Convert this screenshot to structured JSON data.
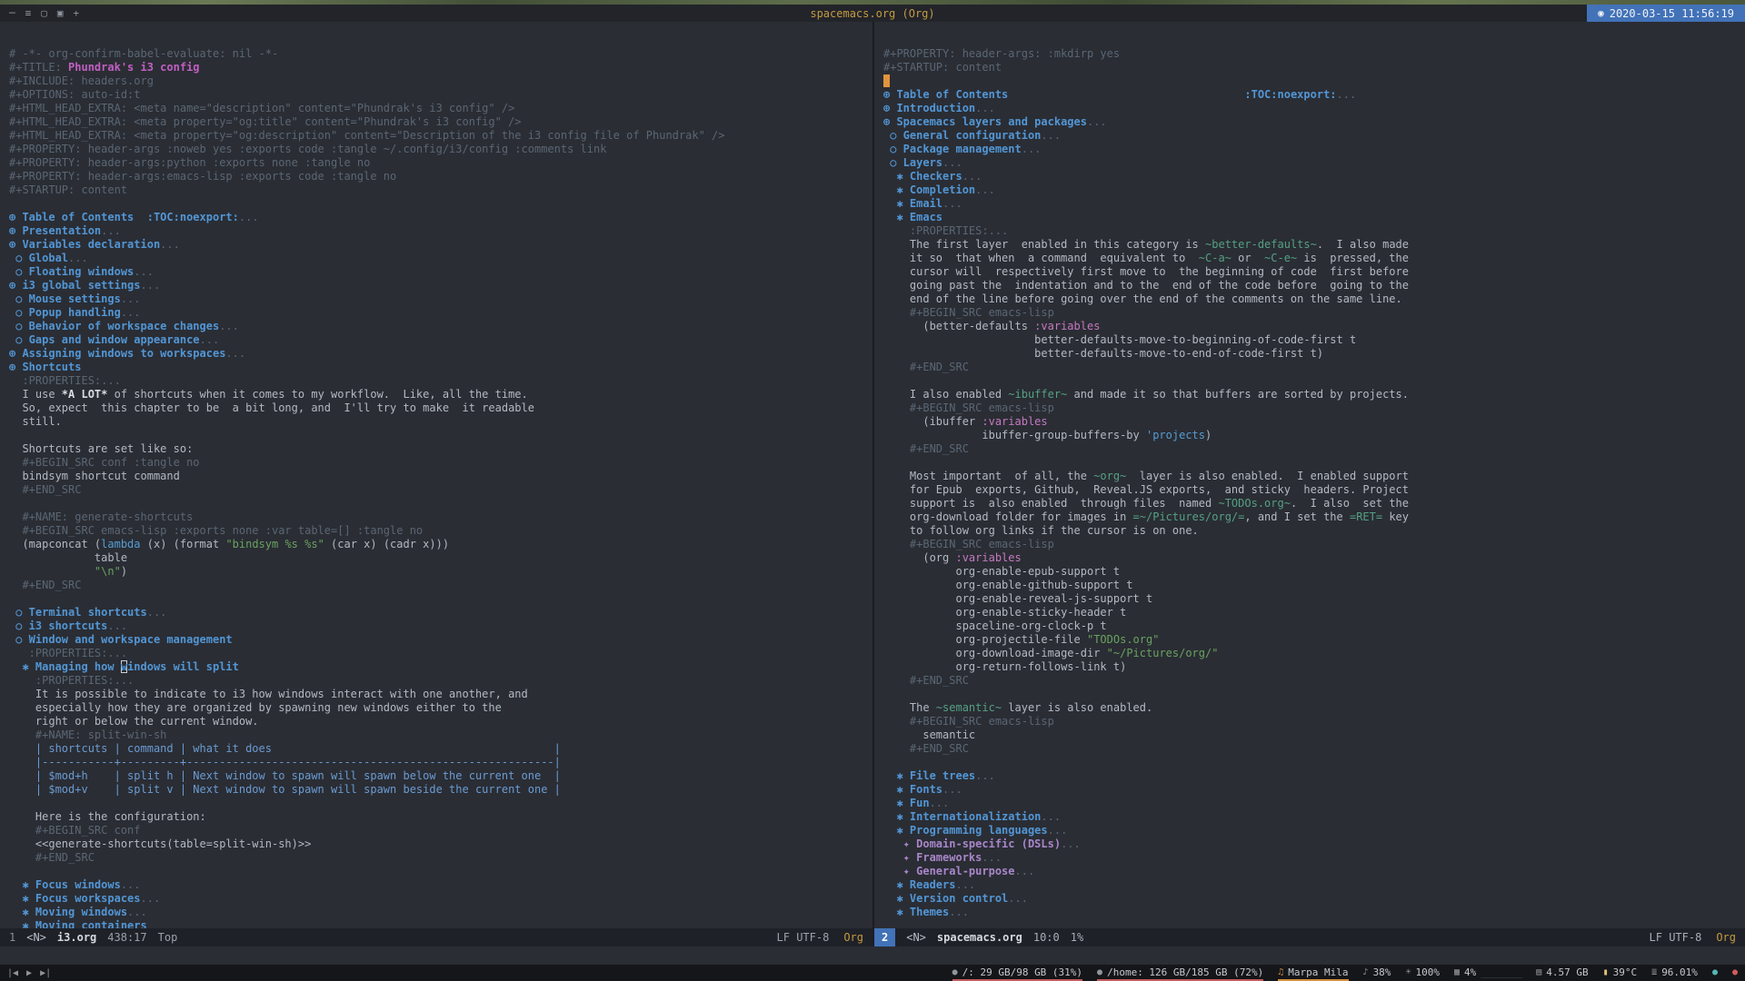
{
  "titlebar": {
    "title": "spacemacs.org (Org)",
    "clock": "2020-03-15 11:56:19",
    "clock_icon": "◉",
    "icons": [
      {
        "name": "minimize-icon",
        "glyph": "─"
      },
      {
        "name": "menu-icon",
        "glyph": "≡"
      },
      {
        "name": "window-icon",
        "glyph": "▢"
      },
      {
        "name": "grid-icon",
        "glyph": "▣"
      },
      {
        "name": "plus-icon",
        "glyph": "+"
      }
    ]
  },
  "left_window": {
    "modeline": {
      "win": "1",
      "state": "<N>",
      "buffer": "i3.org",
      "position": "438:17",
      "scroll": "Top",
      "encoding": "LF UTF-8",
      "mode": "Org"
    },
    "lines": [
      [
        [
          "m",
          "# -*- org-confirm-babel-evaluate: nil -*-"
        ]
      ],
      [
        [
          "m",
          "#+TITLE: "
        ],
        [
          "ti",
          "Phundrak's i3 config"
        ]
      ],
      [
        [
          "m",
          "#+INCLUDE: headers.org"
        ]
      ],
      [
        [
          "m",
          "#+OPTIONS: auto-id:t"
        ]
      ],
      [
        [
          "m",
          "#+HTML_HEAD_EXTRA: <meta name=\"description\" content=\"Phundrak's i3 config\" />"
        ]
      ],
      [
        [
          "m",
          "#+HTML_HEAD_EXTRA: <meta property=\"og:title\" content=\"Phundrak's i3 config\" />"
        ]
      ],
      [
        [
          "m",
          "#+HTML_HEAD_EXTRA: <meta property=\"og:description\" content=\"Description of the i3 config file of Phundrak\" />"
        ]
      ],
      [
        [
          "m",
          "#+PROPERTY: header-args :noweb yes :exports code :tangle ~/.config/i3/config :comments link"
        ]
      ],
      [
        [
          "m",
          "#+PROPERTY: header-args:python :exports none :tangle no"
        ]
      ],
      [
        [
          "m",
          "#+PROPERTY: header-args:emacs-lisp :exports code :tangle no"
        ]
      ],
      [
        [
          "m",
          "#+STARTUP: content"
        ]
      ],
      [],
      [
        [
          "h1",
          "⊕ Table of Contents  :TOC:noexport:"
        ],
        [
          "el",
          "..."
        ]
      ],
      [
        [
          "h1",
          "⊕ Presentation"
        ],
        [
          "el",
          "..."
        ]
      ],
      [
        [
          "h1",
          "⊕ Variables declaration"
        ],
        [
          "el",
          "..."
        ]
      ],
      [
        [
          "h2",
          " ○ Global"
        ],
        [
          "el",
          "..."
        ]
      ],
      [
        [
          "h2",
          " ○ Floating windows"
        ],
        [
          "el",
          "..."
        ]
      ],
      [
        [
          "h1",
          "⊕ i3 global settings"
        ],
        [
          "el",
          "..."
        ]
      ],
      [
        [
          "h2",
          " ○ Mouse settings"
        ],
        [
          "el",
          "..."
        ]
      ],
      [
        [
          "h2",
          " ○ Popup handling"
        ],
        [
          "el",
          "..."
        ]
      ],
      [
        [
          "h2",
          " ○ Behavior of workspace changes"
        ],
        [
          "el",
          "..."
        ]
      ],
      [
        [
          "h2",
          " ○ Gaps and window appearance"
        ],
        [
          "el",
          "..."
        ]
      ],
      [
        [
          "h1",
          "⊕ Assigning windows to workspaces"
        ],
        [
          "el",
          "..."
        ]
      ],
      [
        [
          "h1",
          "⊕ Shortcuts"
        ]
      ],
      [
        [
          "m",
          "  :PROPERTIES:..."
        ]
      ],
      [
        [
          "t",
          "  I use "
        ],
        [
          "b",
          "*A LOT*"
        ],
        [
          "t",
          " of shortcuts when it comes to my workflow.  Like, all the time."
        ]
      ],
      [
        [
          "t",
          "  So, expect  this chapter to be  a bit long, and  I'll try to make  it readable"
        ]
      ],
      [
        [
          "t",
          "  still."
        ]
      ],
      [],
      [
        [
          "t",
          "  Shortcuts are set like so:"
        ]
      ],
      [
        [
          "m",
          "  #+BEGIN_SRC conf :tangle no"
        ]
      ],
      [
        [
          "t",
          "  bindsym shortcut command"
        ]
      ],
      [
        [
          "m",
          "  #+END_SRC"
        ]
      ],
      [],
      [
        [
          "m",
          "  #+NAME: generate-shortcuts"
        ]
      ],
      [
        [
          "m",
          "  #+BEGIN_SRC emacs-lisp :exports none :var table=[] :tangle no"
        ]
      ],
      [
        [
          "t",
          "  (mapconcat ("
        ],
        [
          "kw",
          "lambda"
        ],
        [
          "t",
          " (x) (format "
        ],
        [
          "st",
          "\"bindsym %s %s\""
        ],
        [
          "t",
          " (car x) (cadr x)))"
        ]
      ],
      [
        [
          "t",
          "             table"
        ]
      ],
      [
        [
          "t",
          "             "
        ],
        [
          "st",
          "\"\\n\""
        ],
        [
          "t",
          ")"
        ]
      ],
      [
        [
          "m",
          "  #+END_SRC"
        ]
      ],
      [],
      [
        [
          "h2",
          " ○ Terminal shortcuts"
        ],
        [
          "el",
          "..."
        ]
      ],
      [
        [
          "h2",
          " ○ i3 shortcuts"
        ],
        [
          "el",
          "..."
        ]
      ],
      [
        [
          "h2",
          " ○ Window and workspace management"
        ]
      ],
      [
        [
          "m",
          "   :PROPERTIES:..."
        ]
      ],
      [
        [
          "h3",
          "  ✱ Managing how "
        ],
        [
          "hcur",
          "w"
        ],
        [
          "h3",
          "indows will split"
        ]
      ],
      [
        [
          "m",
          "    :PROPERTIES:..."
        ]
      ],
      [
        [
          "t",
          "    It is possible to indicate to i3 how windows interact with one another, and"
        ]
      ],
      [
        [
          "t",
          "    especially how they are organized by spawning new windows either to the"
        ]
      ],
      [
        [
          "t",
          "    right or below the current window."
        ]
      ],
      [
        [
          "m",
          "    #+NAME: split-win-sh"
        ]
      ],
      [
        [
          "tb",
          "    | shortcuts | command | what it does                                           |"
        ]
      ],
      [
        [
          "tb",
          "    |-----------+---------+--------------------------------------------------------|"
        ]
      ],
      [
        [
          "tb",
          "    | $mod+h    | split h | Next window to spawn will spawn below the current one  |"
        ]
      ],
      [
        [
          "tb",
          "    | $mod+v    | split v | Next window to spawn will spawn beside the current one |"
        ]
      ],
      [],
      [
        [
          "t",
          "    Here is the configuration:"
        ]
      ],
      [
        [
          "m",
          "    #+BEGIN_SRC conf"
        ]
      ],
      [
        [
          "t",
          "    <<generate-shortcuts(table=split-win-sh)>>"
        ]
      ],
      [
        [
          "m",
          "    #+END_SRC"
        ]
      ],
      [],
      [
        [
          "h3",
          "  ✱ Focus windows"
        ],
        [
          "el",
          "..."
        ]
      ],
      [
        [
          "h3",
          "  ✱ Focus workspaces"
        ],
        [
          "el",
          "..."
        ]
      ],
      [
        [
          "h3",
          "  ✱ Moving windows"
        ],
        [
          "el",
          "..."
        ]
      ],
      [
        [
          "h3",
          "  ✱ Moving containers"
        ]
      ]
    ]
  },
  "right_window": {
    "modeline": {
      "win": "2",
      "state": "<N>",
      "buffer": "spacemacs.org",
      "position": "10:0",
      "scroll": "1%",
      "encoding": "LF UTF-8",
      "mode": "Org"
    },
    "lines": [
      [
        [
          "m",
          "#+PROPERTY: header-args: :mkdirp yes"
        ]
      ],
      [
        [
          "m",
          "#+STARTUP: content"
        ]
      ],
      [
        [
          "cur",
          " "
        ]
      ],
      [
        [
          "h1",
          "⊕ Table of Contents"
        ],
        [
          "t",
          "                                    "
        ],
        [
          "h1",
          ":TOC:noexport:"
        ],
        [
          "el",
          "..."
        ]
      ],
      [
        [
          "h1",
          "⊕ Introduction"
        ],
        [
          "el",
          "..."
        ]
      ],
      [
        [
          "h1",
          "⊕ Spacemacs layers and packages"
        ],
        [
          "el",
          "..."
        ]
      ],
      [
        [
          "h2",
          " ○ General configuration"
        ],
        [
          "el",
          "..."
        ]
      ],
      [
        [
          "h2",
          " ○ Package management"
        ],
        [
          "el",
          "..."
        ]
      ],
      [
        [
          "h2",
          " ○ Layers"
        ],
        [
          "el",
          "..."
        ]
      ],
      [
        [
          "h3",
          "  ✱ Checkers"
        ],
        [
          "el",
          "..."
        ]
      ],
      [
        [
          "h3",
          "  ✱ Completion"
        ],
        [
          "el",
          "..."
        ]
      ],
      [
        [
          "h3",
          "  ✱ Email"
        ],
        [
          "el",
          "..."
        ]
      ],
      [
        [
          "h3",
          "  ✱ Emacs"
        ]
      ],
      [
        [
          "m",
          "    :PROPERTIES:..."
        ]
      ],
      [
        [
          "t",
          "    The first layer  enabled in this category is "
        ],
        [
          "cd",
          "~better-defaults~"
        ],
        [
          "t",
          ".  I also made"
        ]
      ],
      [
        [
          "t",
          "    it so  that when  a command  equivalent to  "
        ],
        [
          "cd",
          "~C-a~"
        ],
        [
          "t",
          " or  "
        ],
        [
          "cd",
          "~C-e~"
        ],
        [
          "t",
          " is  pressed, the"
        ]
      ],
      [
        [
          "t",
          "    cursor will  respectively first move to  the beginning of code  first before"
        ]
      ],
      [
        [
          "t",
          "    going past the  indentation and to the  end of the code before  going to the"
        ]
      ],
      [
        [
          "t",
          "    end of the line before going over the end of the comments on the same line."
        ]
      ],
      [
        [
          "m",
          "    #+BEGIN_SRC emacs-lisp"
        ]
      ],
      [
        [
          "t",
          "      (better-defaults "
        ],
        [
          "ct",
          ":variables"
        ]
      ],
      [
        [
          "t",
          "                       better-defaults-move-to-beginning-of-code-first t"
        ]
      ],
      [
        [
          "t",
          "                       better-defaults-move-to-end-of-code-first t)"
        ]
      ],
      [
        [
          "m",
          "    #+END_SRC"
        ]
      ],
      [],
      [
        [
          "t",
          "    I also enabled "
        ],
        [
          "cd",
          "~ibuffer~"
        ],
        [
          "t",
          " and made it so that buffers are sorted by projects."
        ]
      ],
      [
        [
          "m",
          "    #+BEGIN_SRC emacs-lisp"
        ]
      ],
      [
        [
          "t",
          "      (ibuffer "
        ],
        [
          "ct",
          ":variables"
        ]
      ],
      [
        [
          "t",
          "               ibuffer-group-buffers-by "
        ],
        [
          "kw",
          "'projects"
        ],
        [
          "t",
          ")"
        ]
      ],
      [
        [
          "m",
          "    #+END_SRC"
        ]
      ],
      [],
      [
        [
          "t",
          "    Most important  of all, the "
        ],
        [
          "cd",
          "~org~"
        ],
        [
          "t",
          "  layer is also enabled.  I enabled support"
        ]
      ],
      [
        [
          "t",
          "    for Epub  exports, Github,  Reveal.JS exports,  and sticky  headers. Project"
        ]
      ],
      [
        [
          "t",
          "    support is  also enabled  through files  named "
        ],
        [
          "cd",
          "~TODOs.org~"
        ],
        [
          "t",
          ".  I also  set the"
        ]
      ],
      [
        [
          "t",
          "    org-download folder for images in "
        ],
        [
          "cd",
          "=~/Pictures/org/="
        ],
        [
          "t",
          ", and I set the "
        ],
        [
          "cd",
          "=RET="
        ],
        [
          "t",
          " key"
        ]
      ],
      [
        [
          "t",
          "    to follow org links if the cursor is on one."
        ]
      ],
      [
        [
          "m",
          "    #+BEGIN_SRC emacs-lisp"
        ]
      ],
      [
        [
          "t",
          "      (org "
        ],
        [
          "ct",
          ":variables"
        ]
      ],
      [
        [
          "t",
          "           org-enable-epub-support t"
        ]
      ],
      [
        [
          "t",
          "           org-enable-github-support t"
        ]
      ],
      [
        [
          "t",
          "           org-enable-reveal-js-support t"
        ]
      ],
      [
        [
          "t",
          "           org-enable-sticky-header t"
        ]
      ],
      [
        [
          "t",
          "           spaceline-org-clock-p t"
        ]
      ],
      [
        [
          "t",
          "           org-projectile-file "
        ],
        [
          "st",
          "\"TODOs.org\""
        ]
      ],
      [
        [
          "t",
          "           org-download-image-dir "
        ],
        [
          "st",
          "\"~/Pictures/org/\""
        ]
      ],
      [
        [
          "t",
          "           org-return-follows-link t)"
        ]
      ],
      [
        [
          "m",
          "    #+END_SRC"
        ]
      ],
      [],
      [
        [
          "t",
          "    The "
        ],
        [
          "cd",
          "~semantic~"
        ],
        [
          "t",
          " layer is also enabled."
        ]
      ],
      [
        [
          "m",
          "    #+BEGIN_SRC emacs-lisp"
        ]
      ],
      [
        [
          "t",
          "      semantic"
        ]
      ],
      [
        [
          "m",
          "    #+END_SRC"
        ]
      ],
      [],
      [
        [
          "h3",
          "  ✱ File trees"
        ],
        [
          "el",
          "..."
        ]
      ],
      [
        [
          "h3",
          "  ✱ Fonts"
        ],
        [
          "el",
          "..."
        ]
      ],
      [
        [
          "h3",
          "  ✱ Fun"
        ],
        [
          "el",
          "..."
        ]
      ],
      [
        [
          "h3",
          "  ✱ Internationalization"
        ],
        [
          "el",
          "..."
        ]
      ],
      [
        [
          "h3",
          "  ✱ Programming languages"
        ],
        [
          "el",
          "..."
        ]
      ],
      [
        [
          "h4",
          "   ✦ Domain-specific (DSLs)"
        ],
        [
          "el",
          "..."
        ]
      ],
      [
        [
          "h4",
          "   ✦ Frameworks"
        ],
        [
          "el",
          "..."
        ]
      ],
      [
        [
          "h4",
          "   ✦ General-purpose"
        ],
        [
          "el",
          "..."
        ]
      ],
      [
        [
          "h3",
          "  ✱ Readers"
        ],
        [
          "el",
          "..."
        ]
      ],
      [
        [
          "h3",
          "  ✱ Version control"
        ],
        [
          "el",
          "..."
        ]
      ],
      [
        [
          "h3",
          "  ✱ Themes"
        ],
        [
          "el",
          "..."
        ]
      ]
    ]
  },
  "statusbar": {
    "media": [
      {
        "name": "previous-track-icon",
        "glyph": "|◀"
      },
      {
        "name": "play-icon",
        "glyph": "▶"
      },
      {
        "name": "next-track-icon",
        "glyph": "▶|"
      }
    ],
    "modules": [
      {
        "name": "disk-root",
        "icon": "●",
        "icon_color": "#8f959d",
        "text": "/: 29 GB/98 GB (31%)",
        "trail": "",
        "underline": "#c45c5c"
      },
      {
        "name": "disk-home",
        "icon": "●",
        "icon_color": "#8f959d",
        "text": "/home: 126 GB/185 GB (72%)",
        "trail": "",
        "underline": "#c45c5c"
      },
      {
        "name": "player",
        "icon": "♫",
        "icon_color": "#d7903c",
        "text": "Marpa Mila",
        "trail": "",
        "underline": "#d7903c"
      },
      {
        "name": "volume",
        "icon": "♪",
        "icon_color": "#8f959d",
        "text": "38%",
        "trail": "",
        "underline": ""
      },
      {
        "name": "brightness",
        "icon": "☀",
        "icon_color": "#8f959d",
        "text": "100%",
        "trail": "",
        "underline": ""
      },
      {
        "name": "cpu",
        "icon": "▦",
        "icon_color": "#8f959d",
        "text": "4%",
        "trail": "________",
        "underline": ""
      },
      {
        "name": "memory",
        "icon": "▤",
        "icon_color": "#8f959d",
        "text": "4.57 GB",
        "trail": "",
        "underline": ""
      },
      {
        "name": "temperature",
        "icon": "▮",
        "icon_color": "#e5c07b",
        "text": "39°C",
        "trail": "",
        "underline": ""
      },
      {
        "name": "battery",
        "icon": "≣",
        "icon_color": "#8f959d",
        "text": "96.01%",
        "trail": "",
        "underline": ""
      },
      {
        "name": "network-indicator",
        "icon": "●",
        "icon_color": "#56b6b2",
        "text": "",
        "trail": "",
        "underline": ""
      },
      {
        "name": "alert-indicator",
        "icon": "●",
        "icon_color": "#d05c5c",
        "text": "",
        "trail": "",
        "underline": ""
      }
    ]
  },
  "colors": {
    "accent": "#4272b8",
    "cursor": "#e2943c",
    "heading_blue": "#5296d5",
    "heading_purple": "#a986c9"
  }
}
